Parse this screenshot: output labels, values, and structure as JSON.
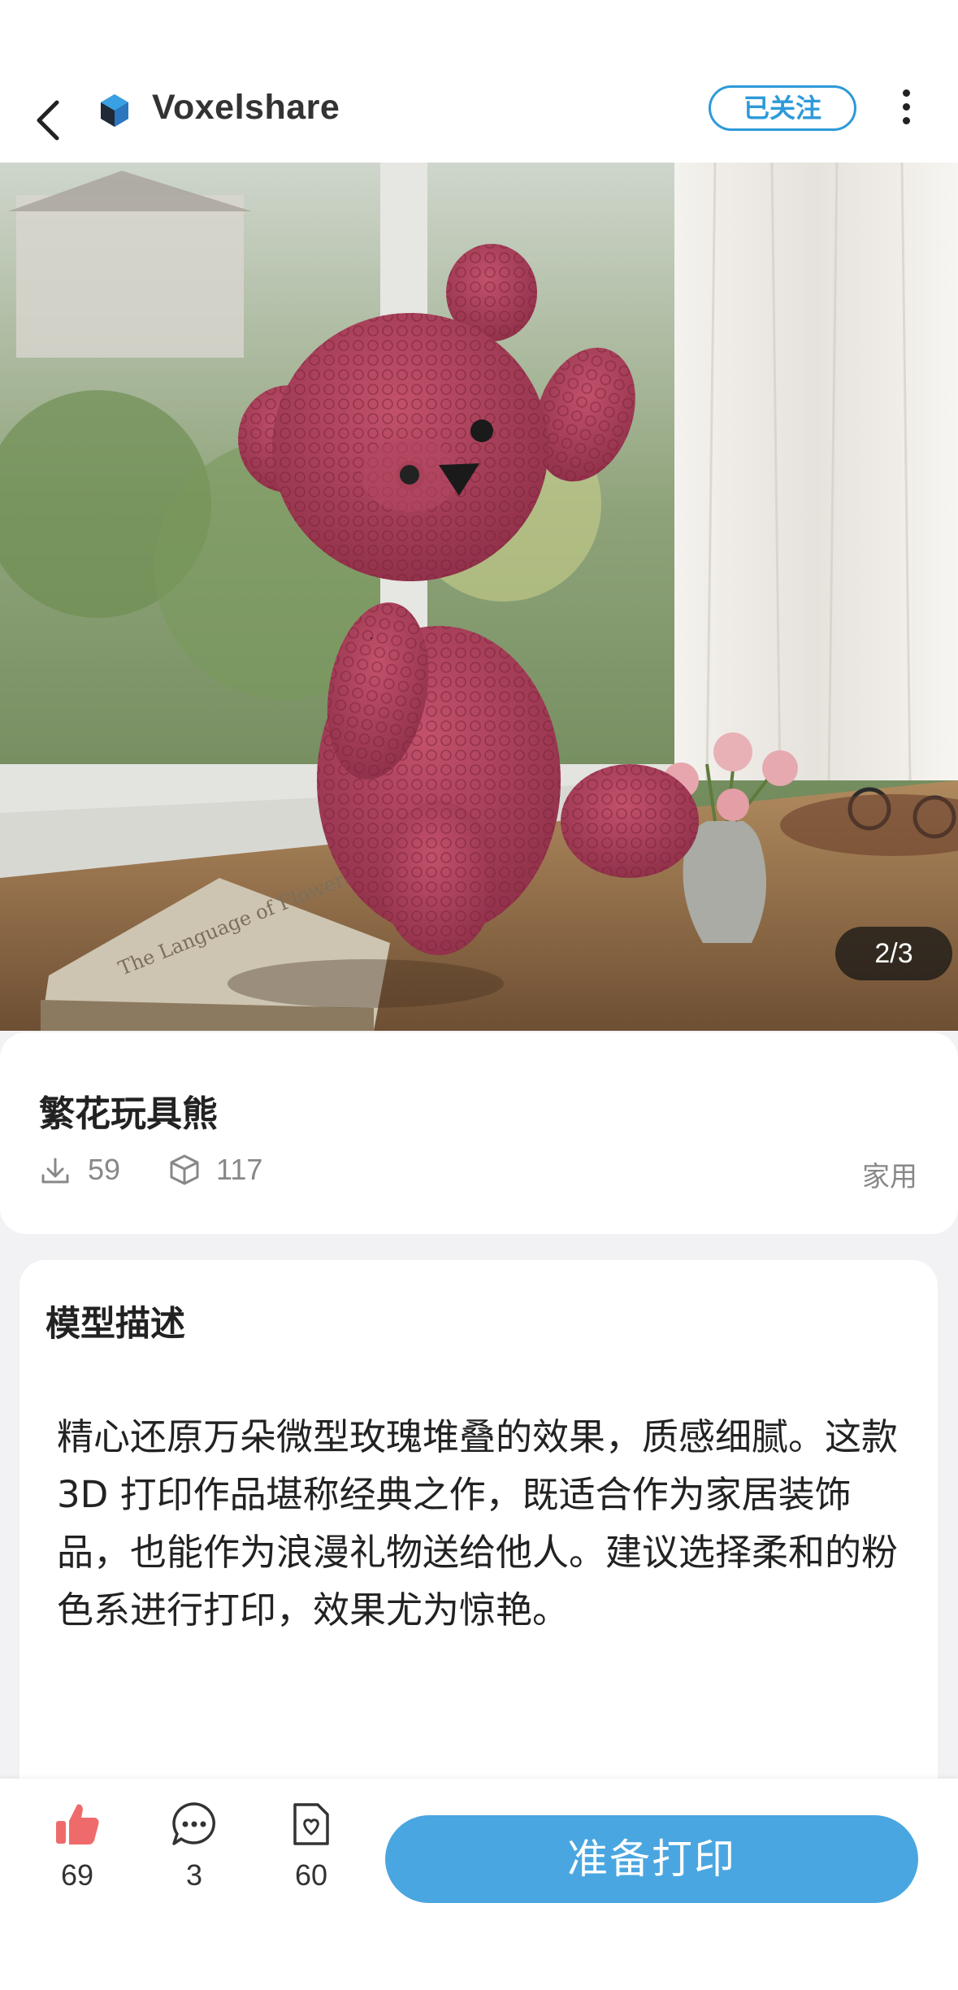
{
  "header": {
    "brand_name": "Voxelshare",
    "follow_label": "已关注"
  },
  "gallery": {
    "page_indicator": "2/3",
    "current": 2,
    "total": 3,
    "book_title": "The Language of Flowers"
  },
  "model": {
    "title": "繁花玩具熊",
    "downloads": "59",
    "prints": "117",
    "category": "家用"
  },
  "description": {
    "heading": "模型描述",
    "text": "精心还原万朵微型玫瑰堆叠的效果，质感细腻。这款 3D 打印作品堪称经典之作，既适合作为家居装饰品，也能作为浪漫礼物送给他人。建议选择柔和的粉色系进行打印，效果尤为惊艳。"
  },
  "actions": {
    "likes": "69",
    "comments": "3",
    "favorites": "60",
    "print_label": "准备打印"
  },
  "colors": {
    "accent": "#2d9ad9",
    "print_button": "#4aa6e0",
    "like_icon": "#ef6b6b"
  }
}
